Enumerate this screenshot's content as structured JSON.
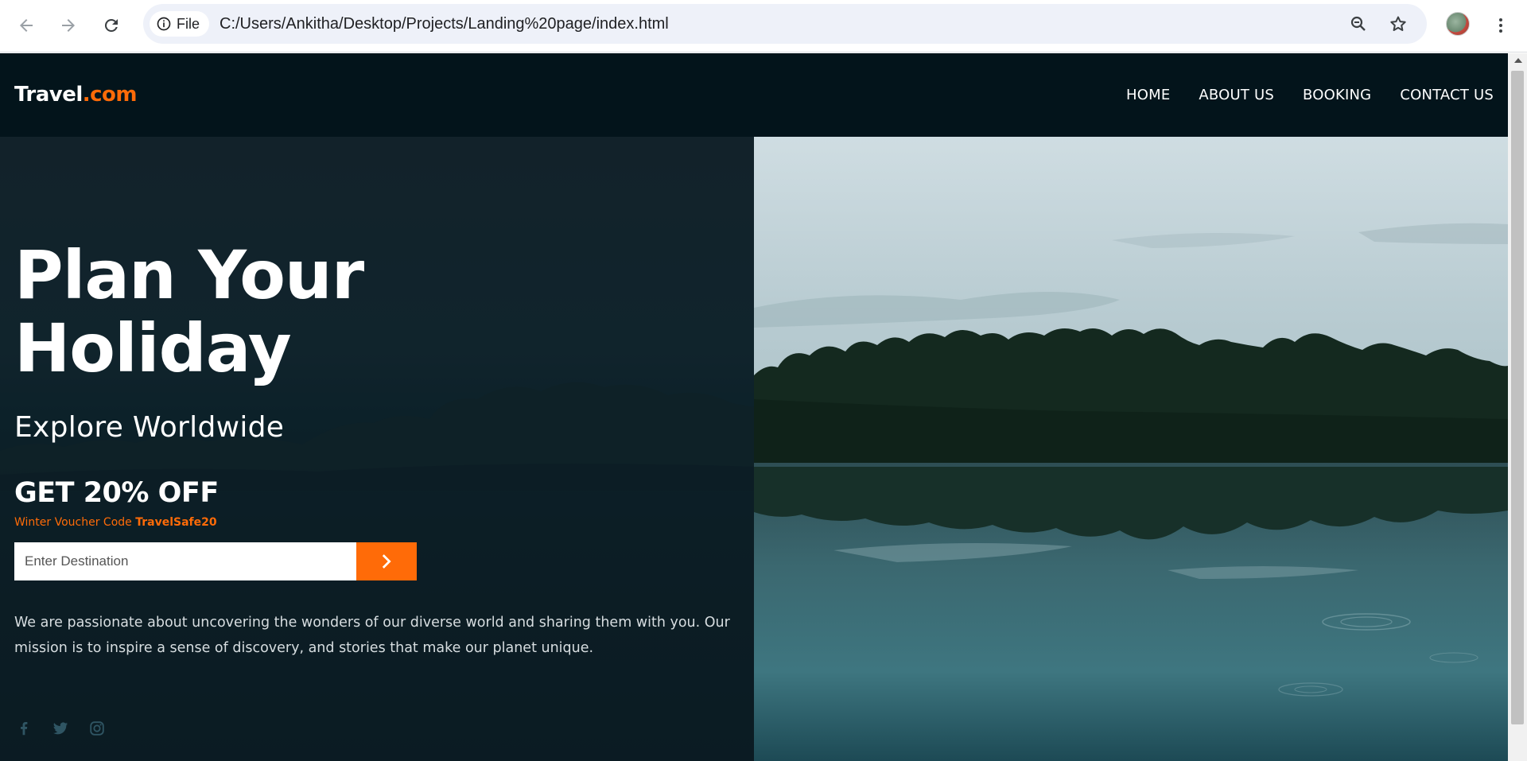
{
  "browser": {
    "site_chip_label": "File",
    "url": "C:/Users/Ankitha/Desktop/Projects/Landing%20page/index.html",
    "icons": [
      "back-arrow-icon",
      "forward-arrow-icon",
      "reload-icon",
      "info-icon",
      "zoom-icon",
      "star-icon",
      "avatar",
      "more-vert-icon"
    ]
  },
  "header": {
    "logo_main": "Travel",
    "logo_accent": ".com",
    "nav": [
      {
        "label": "HOME"
      },
      {
        "label": "ABOUT US"
      },
      {
        "label": "BOOKING"
      },
      {
        "label": "CONTACT US"
      }
    ]
  },
  "hero": {
    "title_line1": "Plan Your",
    "title_line2": "Holiday",
    "subtitle": "Explore Worldwide",
    "offer": "GET 20% OFF",
    "voucher_prefix": "Winter Voucher Code ",
    "voucher_code": "TravelSafe20",
    "search_placeholder": "Enter Destination",
    "description": "We are passionate about uncovering the wonders of our diverse world and sharing them with you. Our mission is to inspire a sense of discovery, and stories that make our planet unique.",
    "socials": [
      "facebook-icon",
      "twitter-icon",
      "instagram-icon"
    ]
  },
  "colors": {
    "accent": "#ff6b08",
    "header_bg": "#03141b",
    "hero_bg": "#17303a"
  }
}
